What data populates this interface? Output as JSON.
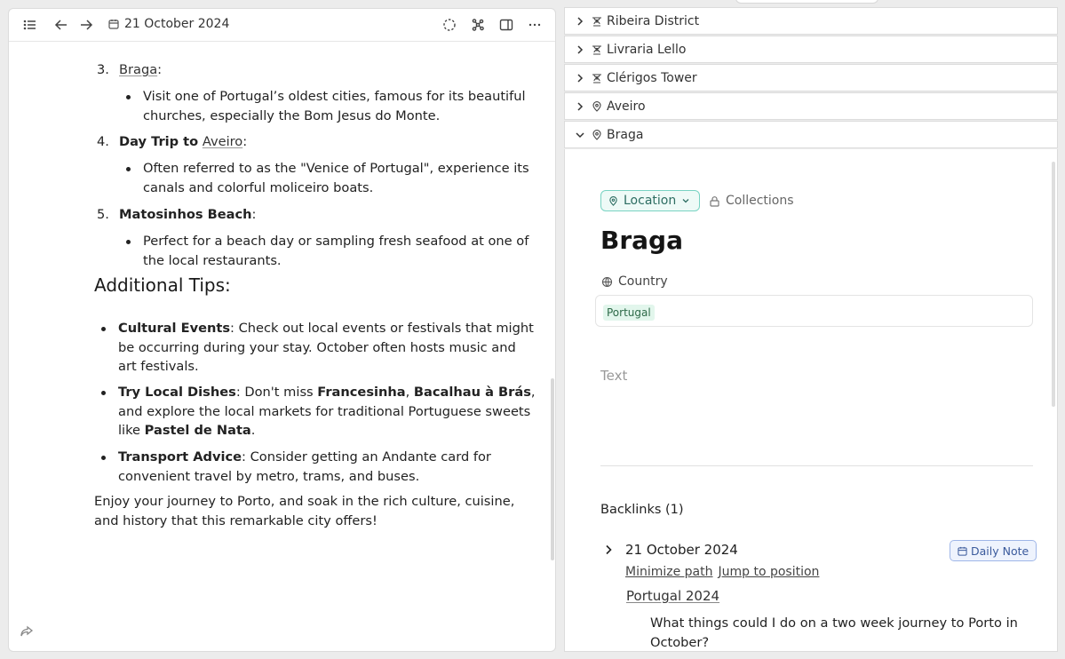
{
  "toolbar": {
    "date": "21 October 2024",
    "icons": [
      "list-icon",
      "back-arrow-icon",
      "forward-arrow-icon",
      "calendar-icon",
      "focus-circle-icon",
      "graph-icon",
      "sidebar-icon",
      "more-icon"
    ]
  },
  "doc": {
    "items": [
      {
        "num": "3.",
        "link": "Braga",
        "suffix": ":",
        "bullet": "Visit one of Portugal’s oldest cities, famous for its beautiful churches, especially the Bom Jesus do Monte."
      },
      {
        "num": "4.",
        "bold": "Day Trip to",
        "link": "Aveiro",
        "suffix": ":",
        "bullet": "Often referred to as the \"Venice of Portugal\", experience its canals and colorful moliceiro boats."
      },
      {
        "num": "5.",
        "bold": "Matosinhos Beach",
        "suffix": ":",
        "bullet": "Perfect for a beach day or sampling fresh seafood at one of the local restaurants."
      }
    ],
    "tips_heading": "Additional Tips:",
    "tips": [
      {
        "bold": "Cultural Events",
        "text": ": Check out local events or festivals that might be occurring during your stay. October often hosts music and art festivals."
      },
      {
        "bold": "Try Local Dishes",
        "t1": ": Don't miss ",
        "b1": "Francesinha",
        "t2": ", ",
        "b2": "Bacalhau à Brás",
        "t3": ", and explore the local markets for traditional Portuguese sweets like ",
        "b3": "Pastel de Nata",
        "t4": "."
      },
      {
        "bold": "Transport Advice",
        "text": ": Consider getting an Andante card for convenient travel by metro, trams, and buses."
      }
    ],
    "closing": "Enjoy your journey to Porto, and soak in the rich culture, cuisine, and history that this remarkable city offers!"
  },
  "tree": {
    "rows": [
      {
        "label": "Ribeira District",
        "icon": "landmark-icon",
        "expanded": false
      },
      {
        "label": "Livraria Lello",
        "icon": "landmark-icon",
        "expanded": false
      },
      {
        "label": "Clérigos Tower",
        "icon": "landmark-icon",
        "expanded": false
      },
      {
        "label": "Aveiro",
        "icon": "location-pin-icon",
        "expanded": false
      },
      {
        "label": "Braga",
        "icon": "location-pin-icon",
        "expanded": true
      }
    ]
  },
  "detail": {
    "tag": "Location",
    "collections": "Collections",
    "title": "Braga",
    "country_label": "Country",
    "country_value": "Portugal",
    "text_placeholder": "Text",
    "backlinks": "Backlinks (1)",
    "backlink_date": "21 October 2024",
    "badge": "Daily Note",
    "minimize": "Minimize path",
    "jump": "Jump to position",
    "path_link": "Portugal 2024",
    "quote": "What things could I do on a two week journey to Porto in October?"
  },
  "colors": {
    "location_accent": "#78d3c3",
    "country_tag": "#e2f6ec",
    "daily_note": "#9fb6e8"
  }
}
